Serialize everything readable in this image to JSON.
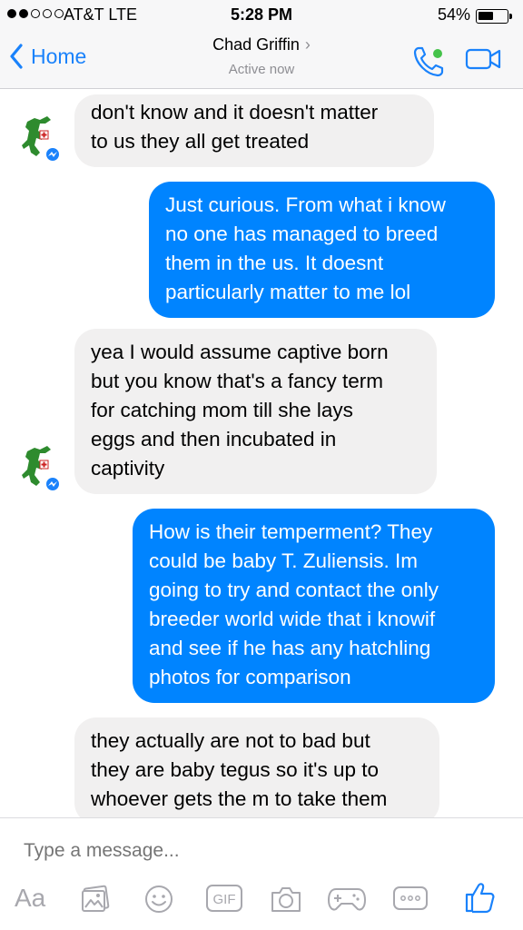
{
  "status_bar": {
    "carrier": "AT&T  LTE",
    "time": "5:28 PM",
    "battery_percent": "54%",
    "battery_level": 0.54,
    "signal_bars": 2,
    "signal_total": 5
  },
  "nav": {
    "back_label": "Home",
    "contact_name": "Chad Griffin",
    "contact_status": "Active now",
    "accent_color": "#1a82fb",
    "online_color": "#44c24a"
  },
  "messages": [
    {
      "direction": "incoming",
      "lines": [
        "don't know and it doesn't matter",
        "to us they all get treated"
      ]
    },
    {
      "direction": "outgoing",
      "lines": [
        "Just curious. From what i know",
        "no one has managed to breed",
        "them in the us. It doesnt",
        "particularly matter to me lol"
      ]
    },
    {
      "direction": "incoming",
      "lines": [
        "yea I would assume captive born",
        "but you know that's a fancy term",
        "for catching mom till she lays",
        "eggs and then incubated in",
        "captivity"
      ]
    },
    {
      "direction": "outgoing",
      "lines": [
        "How is their temperment? They",
        "could be baby T. Zuliensis. Im",
        "going to try and contact the only",
        "breeder world wide that i knowif",
        "and see if he has any hatchling",
        "photos for comparison"
      ]
    },
    {
      "direction": "incoming",
      "lines": [
        "they actually are not to bad but",
        "they are baby tegus so it's up to",
        "whoever gets the m to take them"
      ]
    }
  ],
  "bubble_colors": {
    "incoming": "#f1f0f0",
    "outgoing": "#0084ff"
  },
  "composer": {
    "placeholder": "Type a message...",
    "aa_label": "Aa",
    "gif_label": "GIF",
    "icons": [
      "text-format-icon",
      "photo-icon",
      "emoji-icon",
      "gif-icon",
      "camera-icon",
      "game-icon",
      "more-icon",
      "like-icon"
    ]
  }
}
